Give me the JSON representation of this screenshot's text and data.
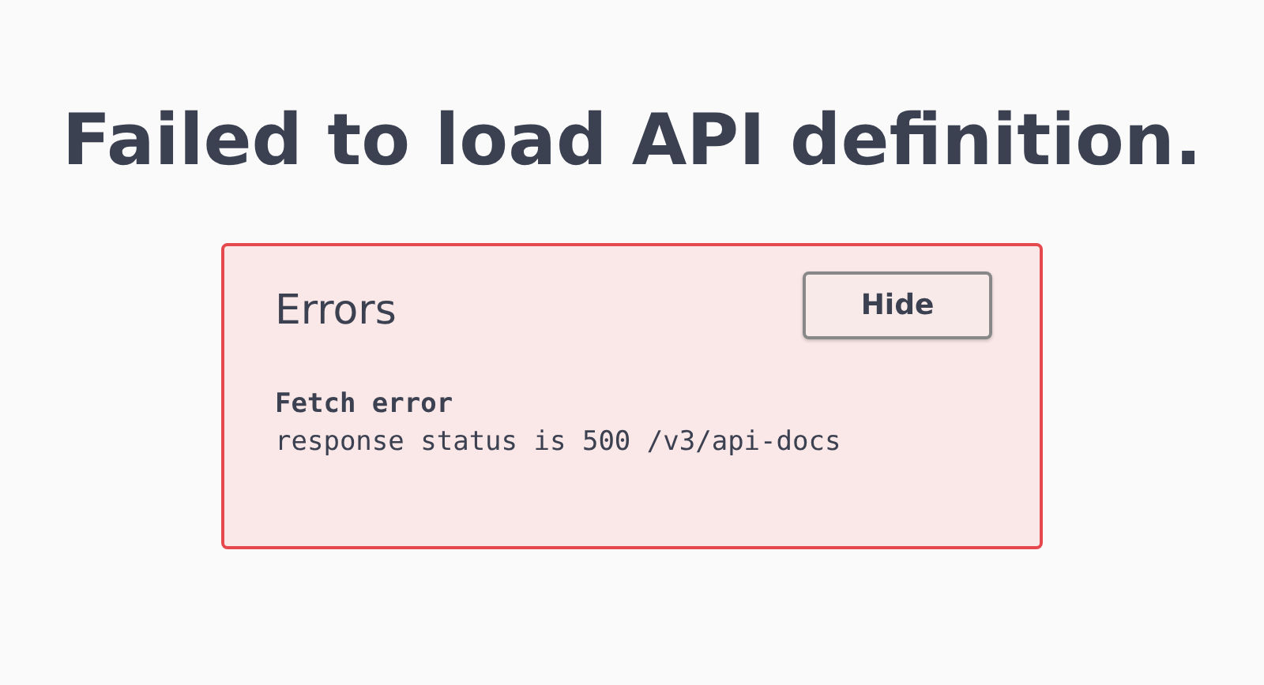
{
  "title": "Failed to load API definition.",
  "errors": {
    "heading": "Errors",
    "hide_button": "Hide",
    "items": [
      {
        "source": "Fetch error",
        "message": "response status is 500 /v3/api-docs"
      }
    ]
  }
}
